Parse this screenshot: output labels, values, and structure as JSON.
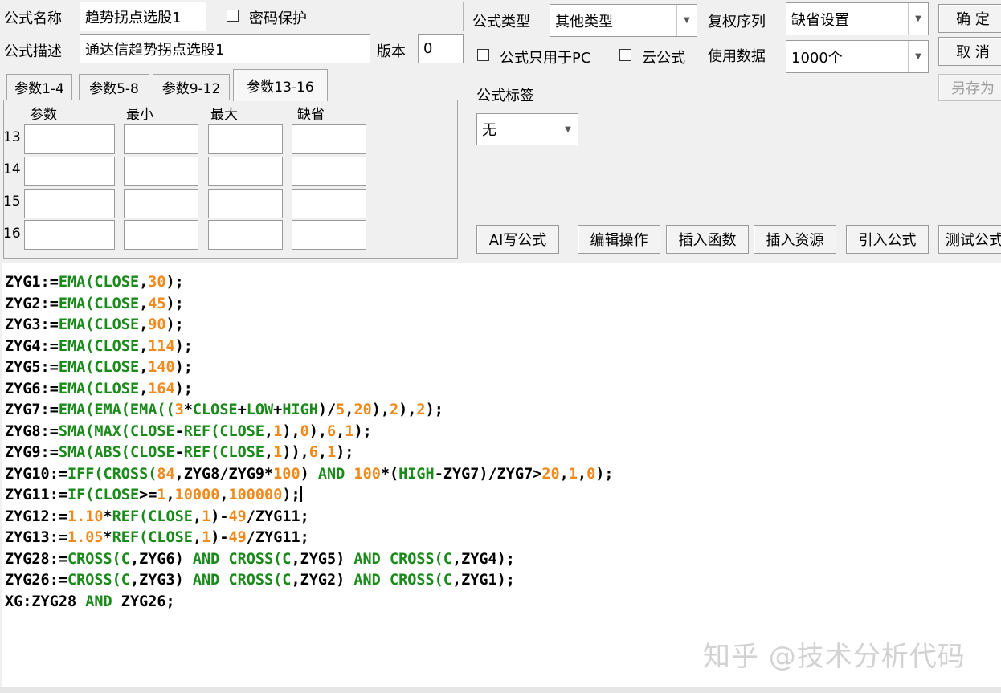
{
  "top": {
    "name_label": "公式名称",
    "name_value": "趋势拐点选股1",
    "password_label": "密码保护",
    "password_value": "",
    "desc_label": "公式描述",
    "desc_value": "通达信趋势拐点选股1",
    "version_label": "版本",
    "version_value": "0",
    "type_label": "公式类型",
    "type_value": "其他类型",
    "restore_label": "复权序列",
    "restore_value": "缺省设置",
    "pc_only_label": "公式只用于PC",
    "cloud_label": "云公式",
    "usedata_label": "使用数据",
    "usedata_value": "1000个",
    "tag_label": "公式标签",
    "tag_value": "无"
  },
  "buttons": {
    "ok": "确  定",
    "cancel": "取  消",
    "save_as": "另存为",
    "ai": "AI写公式",
    "edit_ops": "编辑操作",
    "insert_func": "插入函数",
    "insert_res": "插入资源",
    "import": "引入公式",
    "test": "测试公式"
  },
  "params": {
    "tabs": [
      "参数1-4",
      "参数5-8",
      "参数9-12",
      "参数13-16"
    ],
    "active_tab": "参数13-16",
    "headers": [
      "参数",
      "最小",
      "最大",
      "缺省"
    ],
    "rows": [
      "13",
      "14",
      "15",
      "16"
    ]
  },
  "code": [
    [
      [
        "k",
        "ZYG1:="
      ],
      [
        "g",
        "EMA("
      ],
      [
        "g",
        "CLOSE"
      ],
      [
        "k",
        ","
      ],
      [
        "o",
        "30"
      ],
      [
        "k",
        ");"
      ]
    ],
    [
      [
        "k",
        "ZYG2:="
      ],
      [
        "g",
        "EMA("
      ],
      [
        "g",
        "CLOSE"
      ],
      [
        "k",
        ","
      ],
      [
        "o",
        "45"
      ],
      [
        "k",
        ");"
      ]
    ],
    [
      [
        "k",
        "ZYG3:="
      ],
      [
        "g",
        "EMA("
      ],
      [
        "g",
        "CLOSE"
      ],
      [
        "k",
        ","
      ],
      [
        "o",
        "90"
      ],
      [
        "k",
        ");"
      ]
    ],
    [
      [
        "k",
        "ZYG4:="
      ],
      [
        "g",
        "EMA("
      ],
      [
        "g",
        "CLOSE"
      ],
      [
        "k",
        ","
      ],
      [
        "o",
        "114"
      ],
      [
        "k",
        ");"
      ]
    ],
    [
      [
        "k",
        "ZYG5:="
      ],
      [
        "g",
        "EMA("
      ],
      [
        "g",
        "CLOSE"
      ],
      [
        "k",
        ","
      ],
      [
        "o",
        "140"
      ],
      [
        "k",
        ");"
      ]
    ],
    [
      [
        "k",
        "ZYG6:="
      ],
      [
        "g",
        "EMA("
      ],
      [
        "g",
        "CLOSE"
      ],
      [
        "k",
        ","
      ],
      [
        "o",
        "164"
      ],
      [
        "k",
        ");"
      ]
    ],
    [
      [
        "k",
        "ZYG7:="
      ],
      [
        "g",
        "EMA(EMA(EMA(("
      ],
      [
        "o",
        "3"
      ],
      [
        "k",
        "*"
      ],
      [
        "g",
        "CLOSE"
      ],
      [
        "k",
        "+"
      ],
      [
        "g",
        "LOW"
      ],
      [
        "k",
        "+"
      ],
      [
        "g",
        "HIGH"
      ],
      [
        "k",
        ")/"
      ],
      [
        "o",
        "5"
      ],
      [
        "k",
        ","
      ],
      [
        "o",
        "20"
      ],
      [
        "k",
        "),"
      ],
      [
        "o",
        "2"
      ],
      [
        "k",
        "),"
      ],
      [
        "o",
        "2"
      ],
      [
        "k",
        ");"
      ]
    ],
    [
      [
        "k",
        "ZYG8:="
      ],
      [
        "g",
        "SMA(MAX("
      ],
      [
        "g",
        "CLOSE"
      ],
      [
        "k",
        "-"
      ],
      [
        "g",
        "REF("
      ],
      [
        "g",
        "CLOSE"
      ],
      [
        "k",
        ","
      ],
      [
        "o",
        "1"
      ],
      [
        "k",
        "),"
      ],
      [
        "o",
        "0"
      ],
      [
        "k",
        "),"
      ],
      [
        "o",
        "6"
      ],
      [
        "k",
        ","
      ],
      [
        "o",
        "1"
      ],
      [
        "k",
        ");"
      ]
    ],
    [
      [
        "k",
        "ZYG9:="
      ],
      [
        "g",
        "SMA(ABS("
      ],
      [
        "g",
        "CLOSE"
      ],
      [
        "k",
        "-"
      ],
      [
        "g",
        "REF("
      ],
      [
        "g",
        "CLOSE"
      ],
      [
        "k",
        ","
      ],
      [
        "o",
        "1"
      ],
      [
        "k",
        ")),"
      ],
      [
        "o",
        "6"
      ],
      [
        "k",
        ","
      ],
      [
        "o",
        "1"
      ],
      [
        "k",
        ");"
      ]
    ],
    [
      [
        "k",
        "ZYG10:="
      ],
      [
        "g",
        "IFF(CROSS("
      ],
      [
        "o",
        "84"
      ],
      [
        "k",
        ",ZYG8/ZYG9*"
      ],
      [
        "o",
        "100"
      ],
      [
        "k",
        ") "
      ],
      [
        "g",
        "AND"
      ],
      [
        "k",
        " "
      ],
      [
        "o",
        "100"
      ],
      [
        "k",
        "*("
      ],
      [
        "g",
        "HIGH"
      ],
      [
        "k",
        "-ZYG7)/ZYG7>"
      ],
      [
        "o",
        "20"
      ],
      [
        "k",
        ","
      ],
      [
        "o",
        "1"
      ],
      [
        "k",
        ","
      ],
      [
        "o",
        "0"
      ],
      [
        "k",
        ");"
      ]
    ],
    [
      [
        "k",
        "ZYG11:="
      ],
      [
        "g",
        "IF("
      ],
      [
        "g",
        "CLOSE"
      ],
      [
        "k",
        ">="
      ],
      [
        "o",
        "1"
      ],
      [
        "k",
        ","
      ],
      [
        "o",
        "10000"
      ],
      [
        "k",
        ","
      ],
      [
        "o",
        "100000"
      ],
      [
        "k",
        ");"
      ],
      [
        "cursor",
        ""
      ]
    ],
    [
      [
        "k",
        "ZYG12:="
      ],
      [
        "o",
        "1.10"
      ],
      [
        "k",
        "*"
      ],
      [
        "g",
        "REF("
      ],
      [
        "g",
        "CLOSE"
      ],
      [
        "k",
        ","
      ],
      [
        "o",
        "1"
      ],
      [
        "k",
        ")-"
      ],
      [
        "o",
        "49"
      ],
      [
        "k",
        "/ZYG11;"
      ]
    ],
    [
      [
        "k",
        "ZYG13:="
      ],
      [
        "o",
        "1.05"
      ],
      [
        "k",
        "*"
      ],
      [
        "g",
        "REF("
      ],
      [
        "g",
        "CLOSE"
      ],
      [
        "k",
        ","
      ],
      [
        "o",
        "1"
      ],
      [
        "k",
        ")-"
      ],
      [
        "o",
        "49"
      ],
      [
        "k",
        "/ZYG11;"
      ]
    ],
    [
      [
        "k",
        "ZYG28:="
      ],
      [
        "g",
        "CROSS("
      ],
      [
        "g",
        "C"
      ],
      [
        "k",
        ",ZYG6) "
      ],
      [
        "g",
        "AND"
      ],
      [
        "k",
        " "
      ],
      [
        "g",
        "CROSS("
      ],
      [
        "g",
        "C"
      ],
      [
        "k",
        ",ZYG5) "
      ],
      [
        "g",
        "AND"
      ],
      [
        "k",
        " "
      ],
      [
        "g",
        "CROSS("
      ],
      [
        "g",
        "C"
      ],
      [
        "k",
        ",ZYG4);"
      ]
    ],
    [
      [
        "k",
        "ZYG26:="
      ],
      [
        "g",
        "CROSS("
      ],
      [
        "g",
        "C"
      ],
      [
        "k",
        ",ZYG3) "
      ],
      [
        "g",
        "AND"
      ],
      [
        "k",
        " "
      ],
      [
        "g",
        "CROSS("
      ],
      [
        "g",
        "C"
      ],
      [
        "k",
        ",ZYG2) "
      ],
      [
        "g",
        "AND"
      ],
      [
        "k",
        " "
      ],
      [
        "g",
        "CROSS("
      ],
      [
        "g",
        "C"
      ],
      [
        "k",
        ",ZYG1);"
      ]
    ],
    [
      [
        "k",
        "XG:ZYG28 "
      ],
      [
        "g",
        "AND"
      ],
      [
        "k",
        " ZYG26;"
      ]
    ]
  ],
  "watermark": "知乎 @技术分析代码",
  "colors": {
    "keyword": "#1a8a1a",
    "number": "#f08a1c",
    "text": "#000000"
  }
}
